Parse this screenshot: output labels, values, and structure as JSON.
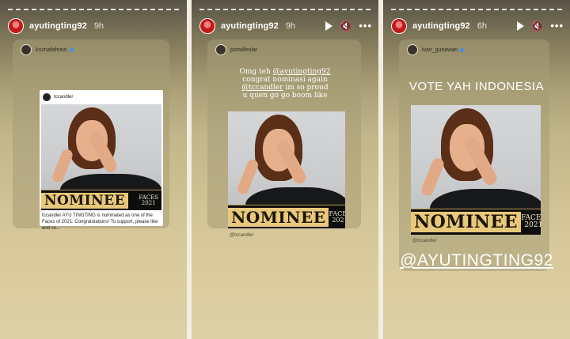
{
  "stories": [
    {
      "username": "ayutingting92",
      "time": "9h",
      "reshared_from": "kriznafahrezi",
      "post_author": "tccandler",
      "post_caption": "tccandler AYU TINGTING is nominated as one of the Faces of 2021. Congratulations! To support, please like and co...",
      "nominee": "NOMINEE",
      "faces_line1": "FACES",
      "faces_line2": "2021"
    },
    {
      "username": "ayutingting92",
      "time": "9h",
      "reshared_from": "portalleslar",
      "message_mention1": "@ayutingting92",
      "message_text1": "Omg teh",
      "message_text2": "congrat nominasi again",
      "message_mention2": "@tccandler",
      "message_text3": "im so proud",
      "message_text4": "u quen go go boom like",
      "nominee": "NOMINEE",
      "faces_line1": "FACES",
      "faces_line2": "2021",
      "photo_tag": "@tccandler"
    },
    {
      "username": "ayutingting92",
      "time": "6h",
      "reshared_from": "ivan_gunawan",
      "headline": "VOTE YAH INDONESIA",
      "nominee": "NOMINEE",
      "faces_line1": "FACES",
      "faces_line2": "2021",
      "photo_tag": "@tccandler",
      "mention": "@AYUTINGTING92"
    }
  ],
  "icons": {
    "play": "play-icon",
    "mute": "speaker-muted-icon",
    "more": "more-horizontal-icon",
    "verified": "verified-badge-icon"
  },
  "colors": {
    "verified": "#3b93ef",
    "avatar_ring": "#c21b1b",
    "nominee_gold": "#e8c87a"
  }
}
